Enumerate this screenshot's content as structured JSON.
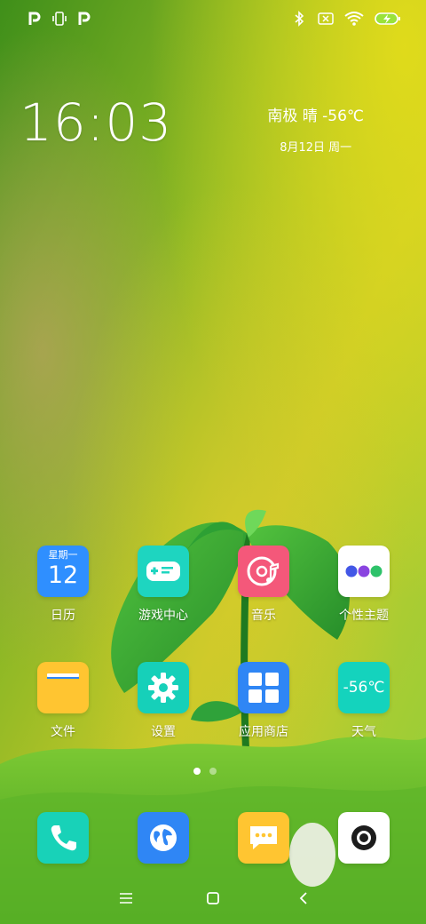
{
  "status_bar": {
    "left_icons": [
      "p-notification-icon",
      "vibrate-icon",
      "p-notification-icon"
    ],
    "right_icons": [
      "bluetooth-icon",
      "no-sim-icon",
      "wifi-icon",
      "battery-charging-icon"
    ]
  },
  "clock": {
    "time": "16:03"
  },
  "weather_widget": {
    "location_weather": "南极 晴 -56℃",
    "date": "8月12日 周一"
  },
  "apps": [
    {
      "id": "calendar",
      "label": "日历",
      "weekday": "星期一",
      "day": "12",
      "icon": "calendar-icon",
      "color": "#2f8fff"
    },
    {
      "id": "game-center",
      "label": "游戏中心",
      "icon": "gamepad-icon",
      "color": "#1ed5c0"
    },
    {
      "id": "music",
      "label": "音乐",
      "icon": "music-disc-icon",
      "color": "#f4587a"
    },
    {
      "id": "themes",
      "label": "个性主题",
      "icon": "theme-dots-icon",
      "color": "#ffffff"
    },
    {
      "id": "files",
      "label": "文件",
      "icon": "folder-icon",
      "color": "#ffc531"
    },
    {
      "id": "settings",
      "label": "设置",
      "icon": "gear-icon",
      "color": "#16d0b9"
    },
    {
      "id": "app-store",
      "label": "应用商店",
      "icon": "app-store-grid-icon",
      "color": "#2f86f5"
    },
    {
      "id": "weather",
      "label": "天气",
      "temp": "-56℃",
      "icon": "weather-temp-icon",
      "color": "#14d3bd"
    }
  ],
  "page_indicator": {
    "pages": 2,
    "active": 1
  },
  "dock": [
    {
      "id": "phone",
      "icon": "phone-icon",
      "color": "#18d2b8"
    },
    {
      "id": "browser",
      "icon": "globe-icon",
      "color": "#2f86f5"
    },
    {
      "id": "messages",
      "icon": "message-icon",
      "color": "#ffc531"
    },
    {
      "id": "camera",
      "icon": "camera-icon",
      "color": "#ffffff"
    }
  ],
  "nav_bar": [
    "menu-icon",
    "home-icon",
    "back-icon"
  ]
}
